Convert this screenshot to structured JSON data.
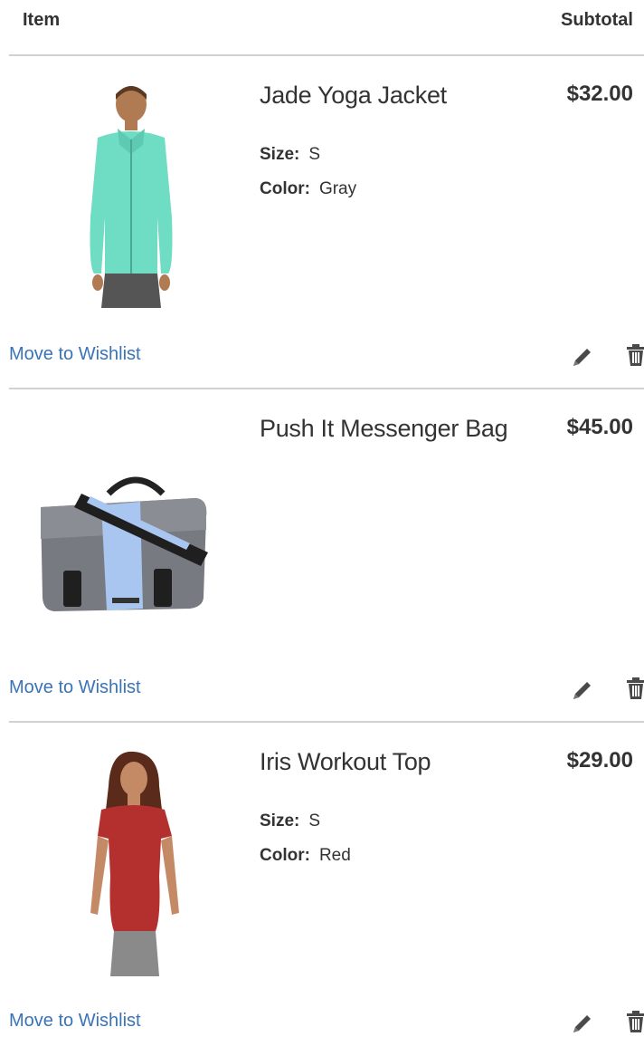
{
  "table_header": {
    "item_label": "Item",
    "subtotal_label": "Subtotal"
  },
  "items": [
    {
      "name": "Jade Yoga Jacket",
      "price": "$32.00",
      "options": [
        {
          "label": "Size:",
          "value": "S"
        },
        {
          "label": "Color:",
          "value": "Gray"
        }
      ],
      "wishlist_label": "Move to Wishlist",
      "image_icon": "jacket-photo"
    },
    {
      "name": "Push It Messenger Bag",
      "price": "$45.00",
      "options": [],
      "wishlist_label": "Move to Wishlist",
      "image_icon": "bag-photo"
    },
    {
      "name": "Iris Workout Top",
      "price": "$29.00",
      "options": [
        {
          "label": "Size:",
          "value": "S"
        },
        {
          "label": "Color:",
          "value": "Red"
        }
      ],
      "wishlist_label": "Move to Wishlist",
      "image_icon": "top-photo"
    }
  ],
  "colors": {
    "link": "#3a73b7",
    "divider": "#d1d1d1",
    "icon": "#4a4a4a"
  },
  "icons": {
    "edit": "pencil-icon",
    "delete": "trash-icon"
  }
}
